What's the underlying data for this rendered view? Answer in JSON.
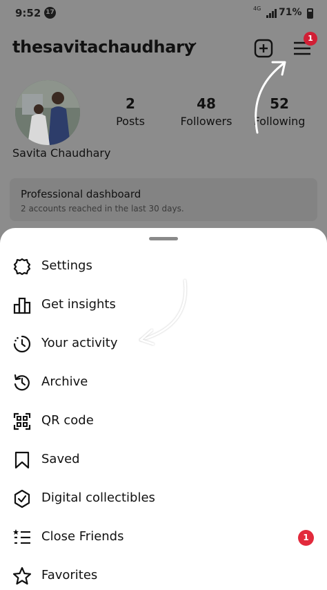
{
  "status_bar": {
    "time": "9:52",
    "notification_count": "17",
    "network": "4G",
    "battery": "71%"
  },
  "profile": {
    "username": "thesavitachaudhary",
    "full_name": "Savita Chaudhary",
    "menu_badge": "1",
    "stats": [
      {
        "value": "2",
        "label": "Posts"
      },
      {
        "value": "48",
        "label": "Followers"
      },
      {
        "value": "52",
        "label": "Following"
      }
    ],
    "professional_dashboard": {
      "title": "Professional dashboard",
      "subtitle": "2 accounts reached in the last 30 days."
    }
  },
  "menu": {
    "items": [
      {
        "label": "Settings",
        "icon": "gear-icon"
      },
      {
        "label": "Get insights",
        "icon": "bar-chart-icon"
      },
      {
        "label": "Your activity",
        "icon": "activity-clock-icon"
      },
      {
        "label": "Archive",
        "icon": "archive-icon"
      },
      {
        "label": "QR code",
        "icon": "qr-code-icon"
      },
      {
        "label": "Saved",
        "icon": "bookmark-icon"
      },
      {
        "label": "Digital collectibles",
        "icon": "shield-check-icon"
      },
      {
        "label": "Close Friends",
        "icon": "close-friends-icon",
        "badge": "1"
      },
      {
        "label": "Favorites",
        "icon": "star-icon"
      }
    ]
  },
  "colors": {
    "badge_red": "#e22a3c",
    "overlay_gray": "#8c8c8c",
    "sheet_white": "#ffffff"
  }
}
